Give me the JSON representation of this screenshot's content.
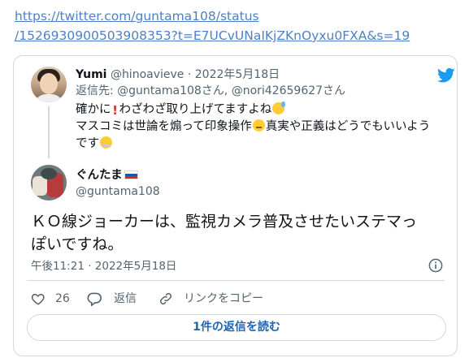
{
  "link": {
    "line1": "https://twitter.com/guntama108/status",
    "line2": "/1526930900503908353?t=E7UCvUNaIKjZKnOyxu0FXA&s=19"
  },
  "quoted_reply": {
    "name": "Yumi",
    "handle": "@hinoavieve",
    "date": "· 2022年5月18日",
    "reply_to": "返信先: @guntama108さん, @nori42659627さん",
    "line1_a": "確かに",
    "line1_b": "わざわざ取り上げてますよね",
    "line2_a": "マスコミは世論を煽って印象操作",
    "line2_b": "真実や正義はどうでもいいよう",
    "line3_a": "です",
    "emojis": [
      "exclamation-icon",
      "sweat-smile-emoji-icon",
      "unamused-emoji-icon",
      "huffing-emoji-icon"
    ]
  },
  "tweet": {
    "name": "ぐんたま",
    "handle": "@guntama108",
    "text_line1": "ＫＯ線ジョーカーは、監視カメラ普及させたいステマっ",
    "text_line2": "ぽいですね。",
    "timestamp": "午後11:21 · 2022年5月18日"
  },
  "actions": {
    "like_count": "26",
    "reply_label": "返信",
    "copy_link_label": "リンクをコピー"
  },
  "read_replies_label": "1件の返信を読む",
  "colors": {
    "link": "#4d80c8",
    "twitter_blue": "#1d9bf0",
    "muted_text": "#536471",
    "border": "#cfd9de",
    "button_text": "#1d64b4"
  }
}
